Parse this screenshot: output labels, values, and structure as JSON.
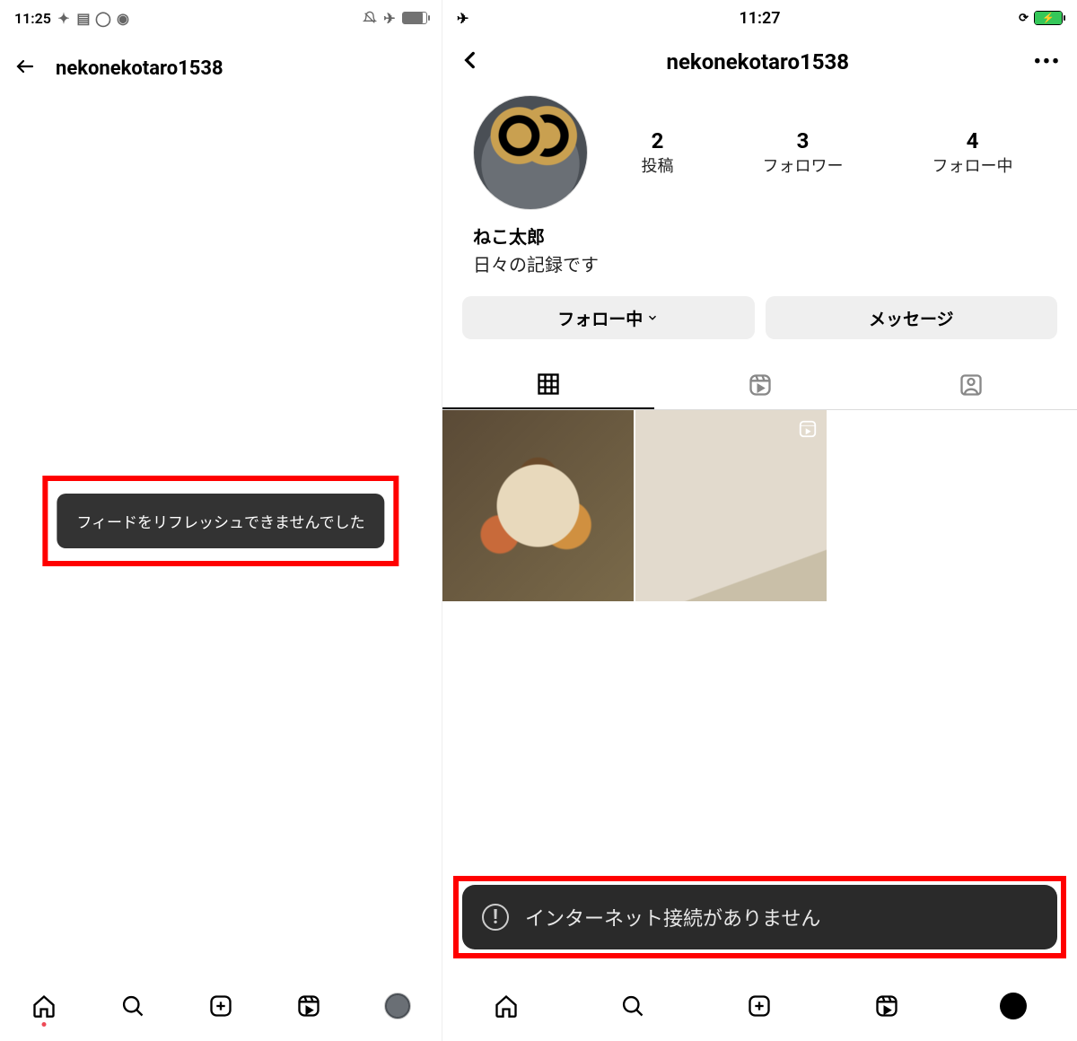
{
  "left": {
    "status_time": "11:25",
    "username": "nekonekotaro1538",
    "toast": "フィードをリフレッシュできませんでした"
  },
  "right": {
    "status_time": "11:27",
    "username": "nekonekotaro1538",
    "stats": {
      "posts_num": "2",
      "posts_label": "投稿",
      "followers_num": "3",
      "followers_label": "フォロワー",
      "following_num": "4",
      "following_label": "フォロー中"
    },
    "bio_name": "ねこ太郎",
    "bio_text": "日々の記録です",
    "follow_btn": "フォロー中",
    "message_btn": "メッセージ",
    "toast": "インターネット接続がありません"
  }
}
